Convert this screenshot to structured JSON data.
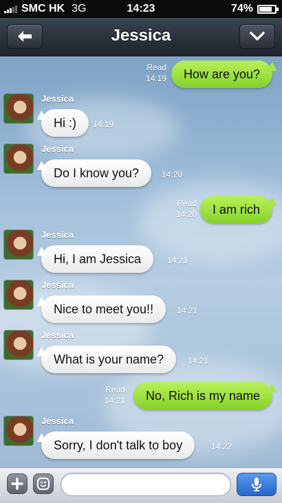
{
  "status_bar": {
    "carrier": "SMC HK",
    "network": "3G",
    "time": "14:23",
    "battery_text": "74%",
    "battery_level": 0.74
  },
  "nav": {
    "title": "Jessica",
    "back_icon": "back-arrow-icon",
    "menu_icon": "chevron-down-icon"
  },
  "messages": [
    {
      "direction": "out",
      "text": "How are you?",
      "status": "Read",
      "time": "14:19"
    },
    {
      "direction": "in",
      "sender": "Jessica",
      "text": "Hi :)",
      "time": "14:19"
    },
    {
      "direction": "in",
      "sender": "Jessica",
      "text": "Do I know you?",
      "time": "14:20"
    },
    {
      "direction": "out",
      "text": "I am rich",
      "status": "Read",
      "time": "14:20"
    },
    {
      "direction": "in",
      "sender": "Jessica",
      "text": "Hi, I am Jessica",
      "time": "14:21"
    },
    {
      "direction": "in",
      "sender": "Jessica",
      "text": "Nice to meet you!!",
      "time": "14:21"
    },
    {
      "direction": "in",
      "sender": "Jessica",
      "text": "What is your name?",
      "time": "14:21"
    },
    {
      "direction": "out",
      "text": "No, Rich is my name",
      "status": "Read",
      "time": "14:21"
    },
    {
      "direction": "in",
      "sender": "Jessica",
      "text": "Sorry, I don't talk to boy",
      "time": "14:22"
    }
  ],
  "input_bar": {
    "message_value": "",
    "icons": [
      "plus-icon",
      "emoticon-icon",
      "microphone-icon"
    ]
  },
  "colors": {
    "outgoing_bubble": "#9fe040",
    "incoming_bubble": "#ffffff",
    "nav_bar": "#2c323b",
    "mic_button": "#3a7be0"
  }
}
